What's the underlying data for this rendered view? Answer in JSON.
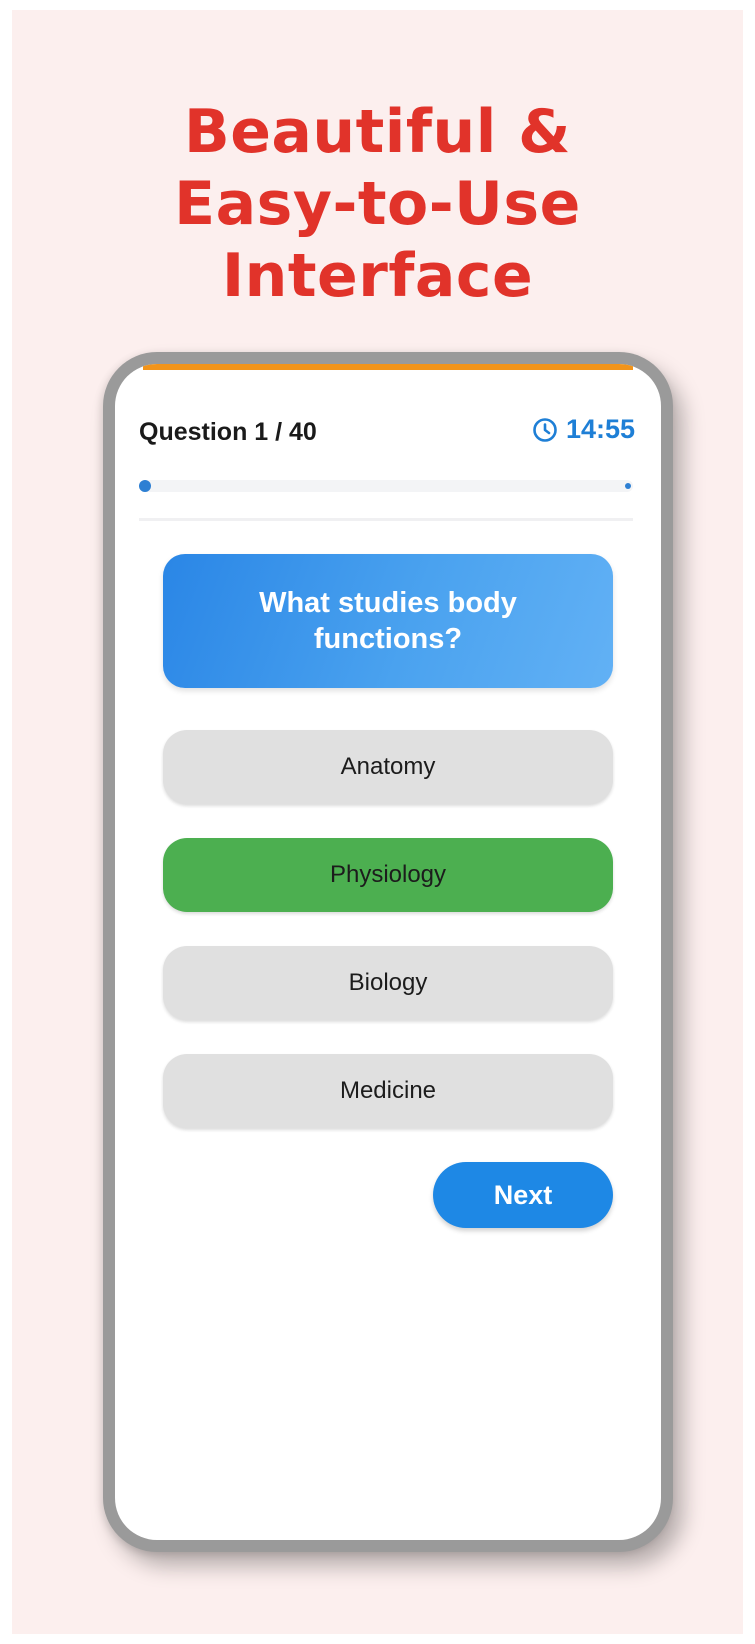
{
  "headline": {
    "line1": "Beautiful &",
    "line2": "Easy-to-Use",
    "line3": "Interface"
  },
  "quiz": {
    "question_counter": "Question 1 / 40",
    "timer_icon": "clock-icon",
    "timer": "14:55",
    "progress_fraction": 0.025,
    "question": "What studies body functions?",
    "options": [
      {
        "label": "Anatomy",
        "state": "default"
      },
      {
        "label": "Physiology",
        "state": "correct"
      },
      {
        "label": "Biology",
        "state": "default"
      },
      {
        "label": "Medicine",
        "state": "default"
      }
    ],
    "next_label": "Next"
  },
  "colors": {
    "headline": "#e1332a",
    "accent_bar": "#f2941a",
    "primary_blue": "#1e88e5",
    "correct_green": "#4caf50",
    "option_gray": "#e0e0e0",
    "background": "#fcefee"
  }
}
